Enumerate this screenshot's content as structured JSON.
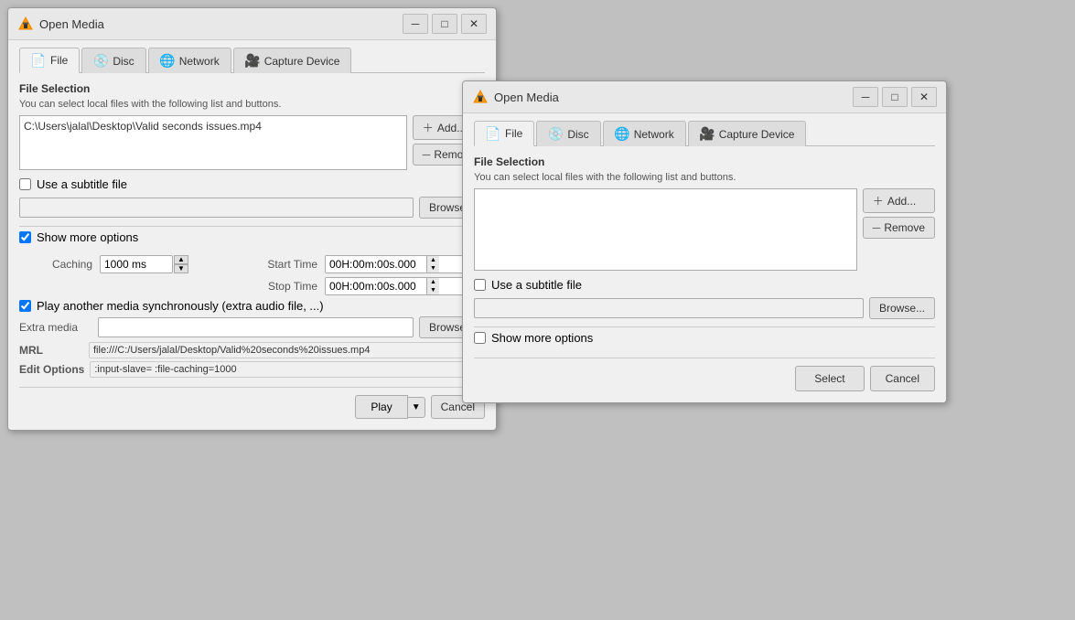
{
  "window1": {
    "title": "Open Media",
    "tabs": [
      {
        "id": "file",
        "label": "File",
        "icon": "📄",
        "active": true
      },
      {
        "id": "disc",
        "label": "Disc",
        "icon": "💿"
      },
      {
        "id": "network",
        "label": "Network",
        "icon": "🌐"
      },
      {
        "id": "capture",
        "label": "Capture Device",
        "icon": "🎥"
      }
    ],
    "fileSelection": {
      "title": "File Selection",
      "desc": "You can select local files with the following list and buttons.",
      "fileValue": "C:\\Users\\jalal\\Desktop\\Valid seconds issues.mp4",
      "addLabel": "Add...",
      "removeLabel": "Remove",
      "subtitleCheckLabel": "Use a subtitle file",
      "browseLabel": "Browse..."
    },
    "showMoreOptions": {
      "label": "Show more options",
      "checked": true
    },
    "caching": {
      "label": "Caching",
      "value": "1000 ms"
    },
    "startTime": {
      "label": "Start Time",
      "value": "00H:00m:00s.000"
    },
    "stopTime": {
      "label": "Stop Time",
      "value": "00H:00m:00s.000"
    },
    "playAnother": {
      "label": "Play another media synchronously (extra audio file, ...)",
      "checked": true
    },
    "extraMedia": {
      "label": "Extra media",
      "browseLabel": "Browse..."
    },
    "mrl": {
      "label": "MRL",
      "value": "file:///C:/Users/jalal/Desktop/Valid%20seconds%20issues.mp4"
    },
    "editOptions": {
      "label": "Edit Options",
      "value": ":input-slave= :file-caching=1000"
    },
    "playLabel": "Play",
    "cancelLabel": "Cancel"
  },
  "window2": {
    "title": "Open Media",
    "tabs": [
      {
        "id": "file",
        "label": "File",
        "icon": "📄",
        "active": true
      },
      {
        "id": "disc",
        "label": "Disc",
        "icon": "💿"
      },
      {
        "id": "network",
        "label": "Network",
        "icon": "🌐"
      },
      {
        "id": "capture",
        "label": "Capture Device",
        "icon": "🎥"
      }
    ],
    "fileSelection": {
      "title": "File Selection",
      "desc": "You can select local files with the following list and buttons.",
      "fileValue": "",
      "addLabel": "Add...",
      "removeLabel": "Remove",
      "subtitleCheckLabel": "Use a subtitle file",
      "browseLabel": "Browse..."
    },
    "showMoreOptions": {
      "label": "Show more options",
      "checked": false
    },
    "selectLabel": "Select",
    "cancelLabel": "Cancel"
  },
  "icons": {
    "vlc": "🟠",
    "minimize": "─",
    "maximize": "□",
    "close": "✕",
    "add": "+",
    "remove": "─",
    "check": "✓"
  }
}
